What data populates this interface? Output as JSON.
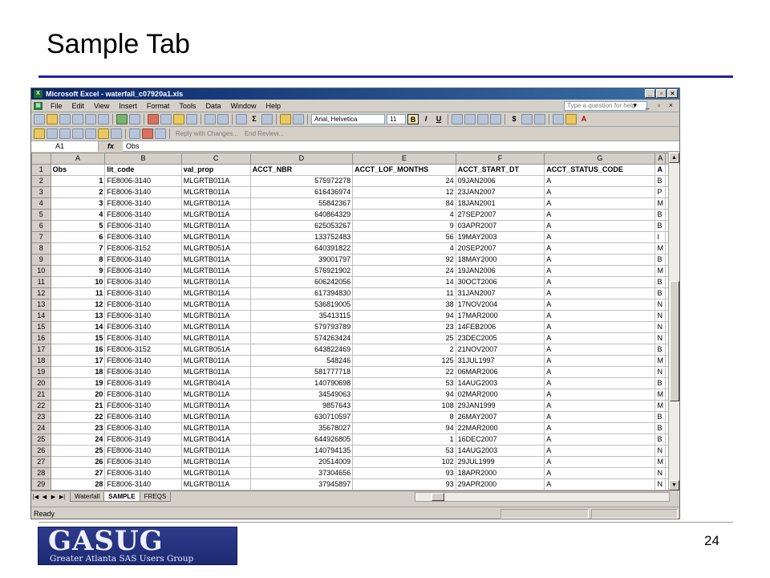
{
  "slide": {
    "title": "Sample Tab",
    "page_number": "24",
    "logo_main": "GASUG",
    "logo_sub": "Greater Atlanta SAS Users Group"
  },
  "excel": {
    "window_title": "Microsoft Excel - waterfall_c07920a1.xls",
    "menu": [
      "File",
      "Edit",
      "View",
      "Insert",
      "Format",
      "Tools",
      "Data",
      "Window",
      "Help"
    ],
    "help_placeholder": "Type a question for help",
    "font_name": "Arial, Helvetica",
    "font_size": "11",
    "review_reply": "Reply with Changes...",
    "review_end": "End Review...",
    "name_box": "A1",
    "fx_label": "fx",
    "formula_value": "Obs",
    "status": "Ready",
    "sheet_tabs": [
      {
        "label": "Waterfall",
        "active": false
      },
      {
        "label": "SAMPLE",
        "active": true
      },
      {
        "label": "FREQS",
        "active": false
      }
    ],
    "columns": [
      "A",
      "B",
      "C",
      "D",
      "E",
      "F",
      "G",
      "A"
    ],
    "headers": [
      "Obs",
      "lit_code",
      "val_prop",
      "ACCT_NBR",
      "ACCT_LOF_MONTHS",
      "ACCT_START_DT",
      "ACCT_STATUS_CODE",
      "A"
    ],
    "rows": [
      [
        "1",
        "FE8006-3140",
        "MLGRTB011A",
        "575972278",
        "24",
        "09JAN2006",
        "A",
        "B"
      ],
      [
        "2",
        "FE8006-3140",
        "MLGRTB011A",
        "616436974",
        "12",
        "23JAN2007",
        "A",
        "P"
      ],
      [
        "3",
        "FE8006-3140",
        "MLGRTB011A",
        "55842367",
        "84",
        "18JAN2001",
        "A",
        "M"
      ],
      [
        "4",
        "FE8006-3140",
        "MLGRTB011A",
        "640864329",
        "4",
        "27SEP2007",
        "A",
        "B"
      ],
      [
        "5",
        "FE8006-3140",
        "MLGRTB011A",
        "625053267",
        "9",
        "03APR2007",
        "A",
        "B"
      ],
      [
        "6",
        "FE8006-3140",
        "MLGRTB011A",
        "133752483",
        "56",
        "19MAY2003",
        "A",
        "I"
      ],
      [
        "7",
        "FE8006-3152",
        "MLGRTB051A",
        "640391822",
        "4",
        "20SEP2007",
        "A",
        "M"
      ],
      [
        "8",
        "FE8006-3140",
        "MLGRTB011A",
        "39001797",
        "92",
        "18MAY2000",
        "A",
        "B"
      ],
      [
        "9",
        "FE8006-3140",
        "MLGRTB011A",
        "576921902",
        "24",
        "19JAN2006",
        "A",
        "M"
      ],
      [
        "10",
        "FE8006-3140",
        "MLGRTB011A",
        "606242056",
        "14",
        "30OCT2006",
        "A",
        "B"
      ],
      [
        "11",
        "FE8006-3140",
        "MLGRTB011A",
        "617394830",
        "11",
        "31JAN2007",
        "A",
        "B"
      ],
      [
        "12",
        "FE8006-3140",
        "MLGRTB011A",
        "536819005",
        "38",
        "17NOV2004",
        "A",
        "N"
      ],
      [
        "13",
        "FE8006-3140",
        "MLGRTB011A",
        "35413115",
        "94",
        "17MAR2000",
        "A",
        "N"
      ],
      [
        "14",
        "FE8006-3140",
        "MLGRTB011A",
        "579793789",
        "23",
        "14FEB2006",
        "A",
        "N"
      ],
      [
        "15",
        "FE8006-3140",
        "MLGRTB011A",
        "574263424",
        "25",
        "23DEC2005",
        "A",
        "N"
      ],
      [
        "16",
        "FE8006-3152",
        "MLGRTB051A",
        "643822469",
        "2",
        "21NOV2007",
        "A",
        "B"
      ],
      [
        "17",
        "FE8006-3140",
        "MLGRTB011A",
        "548246",
        "125",
        "31JUL1997",
        "A",
        "M"
      ],
      [
        "18",
        "FE8006-3140",
        "MLGRTB011A",
        "581777718",
        "22",
        "06MAR2006",
        "A",
        "N"
      ],
      [
        "19",
        "FE8006-3149",
        "MLGRTB041A",
        "140790698",
        "53",
        "14AUG2003",
        "A",
        "B"
      ],
      [
        "20",
        "FE8006-3140",
        "MLGRTB011A",
        "34549063",
        "94",
        "02MAR2000",
        "A",
        "M"
      ],
      [
        "21",
        "FE8006-3140",
        "MLGRTB011A",
        "9857643",
        "108",
        "29JAN1999",
        "A",
        "M"
      ],
      [
        "22",
        "FE8006-3140",
        "MLGRTB011A",
        "630710597",
        "8",
        "26MAY2007",
        "A",
        "B"
      ],
      [
        "23",
        "FE8006-3140",
        "MLGRTB011A",
        "35678027",
        "94",
        "22MAR2000",
        "A",
        "B"
      ],
      [
        "24",
        "FE8006-3149",
        "MLGRTB041A",
        "644926805",
        "1",
        "16DEC2007",
        "A",
        "B"
      ],
      [
        "25",
        "FE8006-3140",
        "MLGRTB011A",
        "140794135",
        "53",
        "14AUG2003",
        "A",
        "N"
      ],
      [
        "26",
        "FE8006-3140",
        "MLGRTB011A",
        "20514009",
        "102",
        "29JUL1999",
        "A",
        "M"
      ],
      [
        "27",
        "FE8006-3140",
        "MLGRTB011A",
        "37304656",
        "93",
        "18APR2000",
        "A",
        "N"
      ],
      [
        "28",
        "FE8006-3140",
        "MLGRTB011A",
        "37945897",
        "93",
        "29APR2000",
        "A",
        "N"
      ]
    ]
  }
}
